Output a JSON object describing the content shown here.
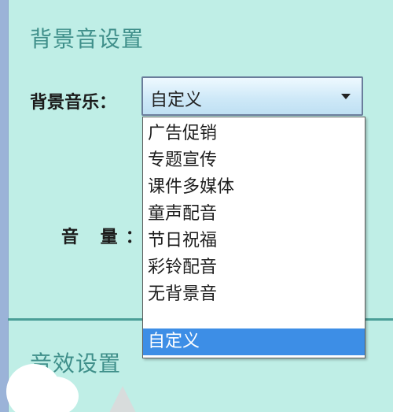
{
  "background_settings": {
    "heading": "背景音设置",
    "music_label": "背景音乐：",
    "volume_label": "音 量："
  },
  "music_select": {
    "value": "自定义",
    "options": [
      "广告促销",
      "专题宣传",
      "课件多媒体",
      "童声配音",
      "节日祝福",
      "彩铃配音",
      "无背景音",
      "自定义"
    ],
    "selected_index": 7
  },
  "sound_effect_settings": {
    "heading": "音效设置"
  },
  "colors": {
    "background": "#bfeee6",
    "heading": "#3f8f8a",
    "selection": "#3d8ee6",
    "divider": "#4a9e97"
  },
  "icons": {
    "select_arrow": "triangle-down-icon"
  }
}
